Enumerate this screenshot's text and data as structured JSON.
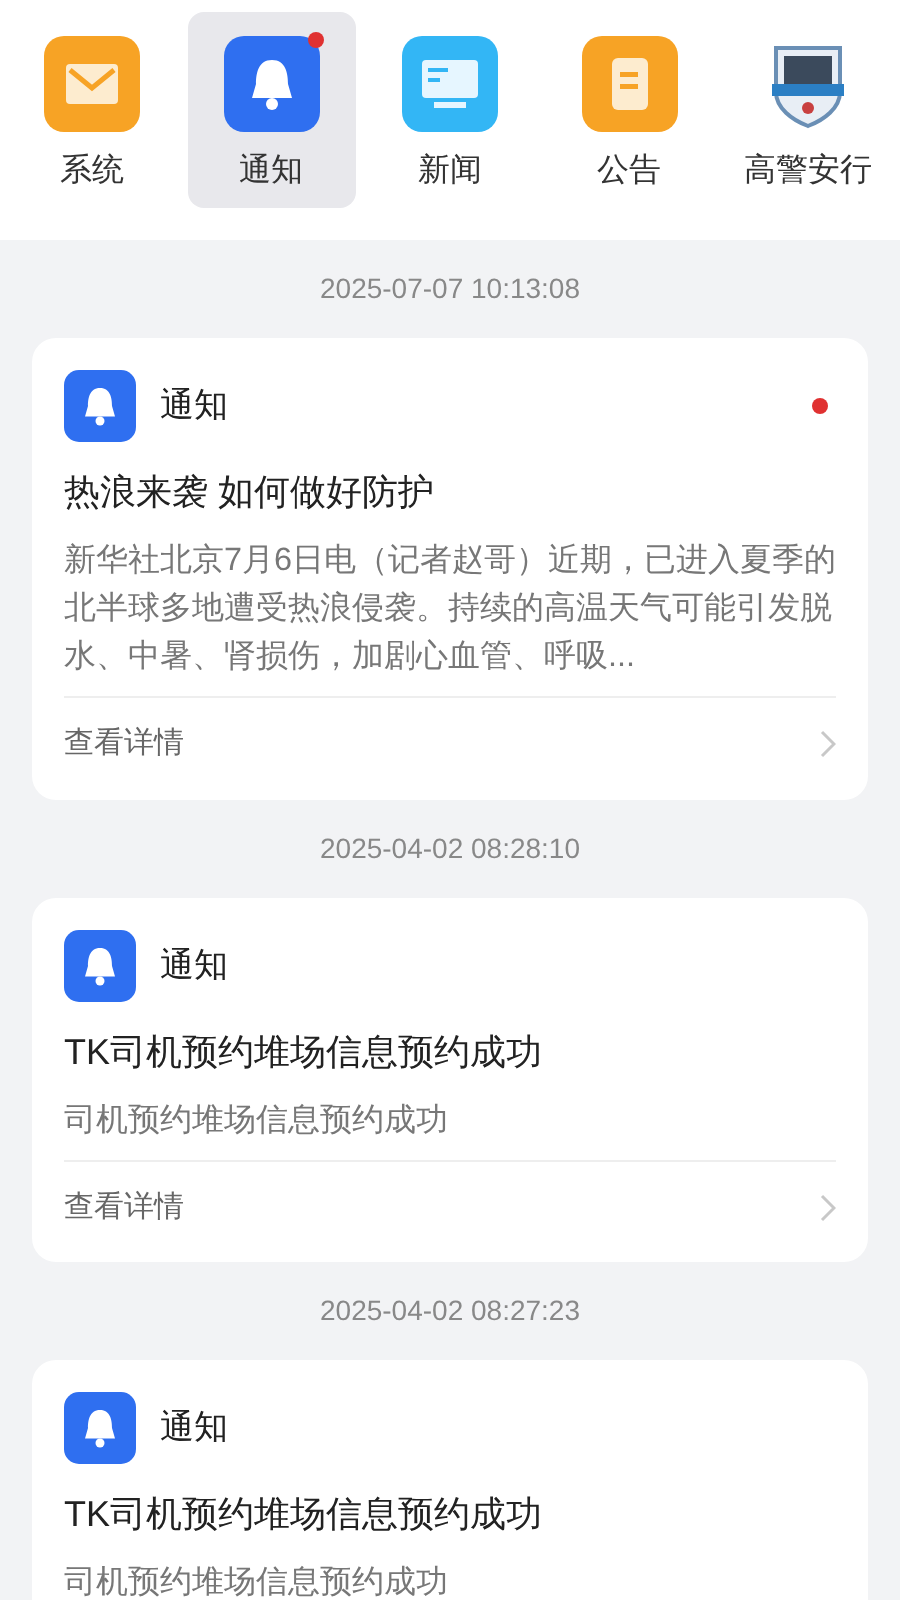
{
  "categories": [
    {
      "label": "系统",
      "kind": "mail",
      "selected": false,
      "unread": false
    },
    {
      "label": "通知",
      "kind": "bell",
      "selected": true,
      "unread": true
    },
    {
      "label": "新闻",
      "kind": "monitor",
      "selected": false,
      "unread": false
    },
    {
      "label": "公告",
      "kind": "note",
      "selected": false,
      "unread": false
    },
    {
      "label": "高警安行",
      "kind": "badge",
      "selected": false,
      "unread": false
    }
  ],
  "messages": [
    {
      "time": "2025-07-07 10:13:08",
      "source": "通知",
      "unread": true,
      "title": "热浪来袭 如何做好防护",
      "body": "新华社北京7月6日电（记者赵哥）近期，已进入夏季的北半球多地遭受热浪侵袭。持续的高温天气可能引发脱水、中暑、肾损伤，加剧心血管、呼吸...",
      "link": "查看详情"
    },
    {
      "time": "2025-04-02 08:28:10",
      "source": "通知",
      "unread": false,
      "title": "TK司机预约堆场信息预约成功",
      "body": "司机预约堆场信息预约成功",
      "link": "查看详情"
    },
    {
      "time": "2025-04-02 08:27:23",
      "source": "通知",
      "unread": false,
      "title": "TK司机预约堆场信息预约成功",
      "body": "司机预约堆场信息预约成功"
    }
  ]
}
